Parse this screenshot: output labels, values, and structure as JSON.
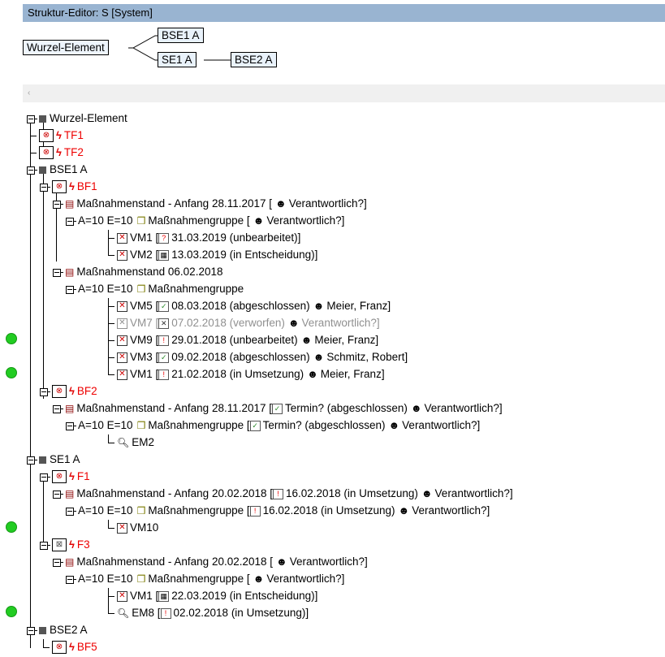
{
  "window": {
    "title": "Struktur-Editor: S [System]"
  },
  "structure": {
    "root": "Wurzel-Element",
    "nodes": [
      "BSE1 A",
      "SE1 A",
      "BSE2 A"
    ]
  },
  "scroll": {
    "left_arrow": "‹"
  },
  "colors": {
    "titlebar": "#99b4d1",
    "error_red": "#ee0000",
    "status_dot": "#22cc22",
    "muted": "#909090"
  },
  "icons": {
    "function_node": "function-icon",
    "fault": "lightning-icon",
    "measure_state": "document-icon",
    "measure_group": "folder-icon",
    "measure": "x-box-icon",
    "calendar": "calendar-icon",
    "person": "person-icon",
    "detection": "magnifier-icon"
  },
  "tree": {
    "rows": [
      {
        "text": "Wurzel-Element"
      },
      {
        "text": "TF1"
      },
      {
        "text": "TF2"
      },
      {
        "text": "BSE1 A"
      },
      {
        "text": "BF1"
      },
      {
        "text": "Maßnahmenstand - Anfang 28.11.2017 [",
        "resp": "Verantwortlich?]"
      },
      {
        "prefix": "A=10 E=10",
        "text": "Maßnahmengruppe [",
        "resp": "Verantwortlich?]"
      },
      {
        "text": "VM1 [",
        "date": "31.03.2019 (unbearbeitet)]"
      },
      {
        "text": "VM2 [",
        "date": "13.03.2019 (in Entscheidung)]"
      },
      {
        "text": "Maßnahmenstand 06.02.2018"
      },
      {
        "prefix": "A=10 E=10",
        "text": "Maßnahmengruppe"
      },
      {
        "text": "VM5 [",
        "date": "08.03.2018 (abgeschlossen)",
        "resp": "Meier, Franz]"
      },
      {
        "text": "VM7 [",
        "date": "07.02.2018 (verworfen)",
        "resp": "Verantwortlich?]"
      },
      {
        "text": "VM9 [",
        "date": "29.01.2018 (unbearbeitet)",
        "resp": "Meier, Franz]"
      },
      {
        "text": "VM3 [",
        "date": "09.02.2018 (abgeschlossen)",
        "resp": "Schmitz, Robert]"
      },
      {
        "text": "VM1 [",
        "date": "21.02.2018 (in Umsetzung)",
        "resp": "Meier, Franz]"
      },
      {
        "text": "BF2"
      },
      {
        "text": "Maßnahmenstand - Anfang 28.11.2017 [",
        "date": "Termin? (abgeschlossen)",
        "resp": "Verantwortlich?]"
      },
      {
        "prefix": "A=10 E=10",
        "text": "Maßnahmengruppe [",
        "date": "Termin? (abgeschlossen)",
        "resp": "Verantwortlich?]"
      },
      {
        "text": "EM2"
      },
      {
        "text": "SE1 A"
      },
      {
        "text": "F1"
      },
      {
        "text": "Maßnahmenstand - Anfang 20.02.2018 [",
        "date": "16.02.2018 (in Umsetzung)",
        "resp": "Verantwortlich?]"
      },
      {
        "prefix": "A=10 E=10",
        "text": "Maßnahmengruppe [",
        "date": "16.02.2018 (in Umsetzung)",
        "resp": "Verantwortlich?]"
      },
      {
        "text": "VM10"
      },
      {
        "text": "F3"
      },
      {
        "text": "Maßnahmenstand - Anfang 20.02.2018 [",
        "resp": "Verantwortlich?]"
      },
      {
        "prefix": "A=10 E=10",
        "text": "Maßnahmengruppe [",
        "resp": "Verantwortlich?]"
      },
      {
        "text": "VM1 [",
        "date": "22.03.2019 (in Entscheidung)]"
      },
      {
        "text": "EM8 [",
        "date": "02.02.2018 (in Umsetzung)]"
      },
      {
        "text": "BSE2 A"
      },
      {
        "text": "BF5"
      }
    ]
  }
}
